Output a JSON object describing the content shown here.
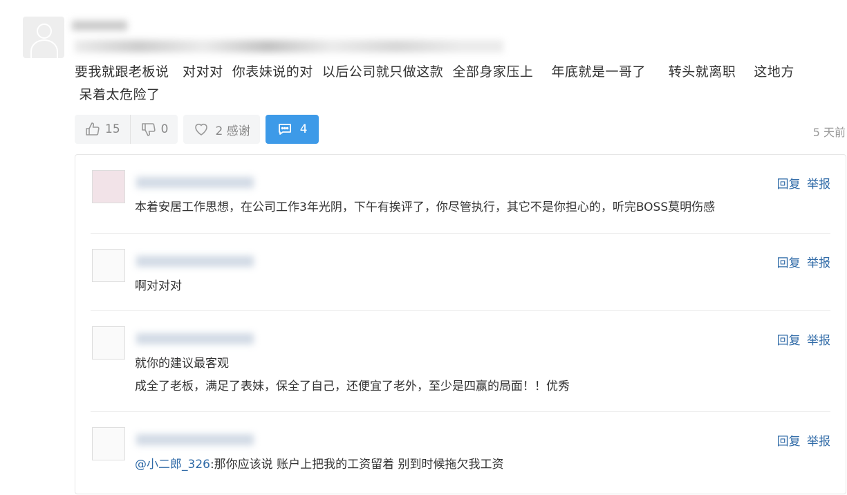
{
  "comment": {
    "body": "要我就跟老板说   对对对  你表妹说的对  以后公司就只做这款  全部身家压上    年底就是一哥了     转头就离职    这地方\n 呆着太危险了",
    "likes": "15",
    "dislikes": "0",
    "thanks": "2 感谢",
    "comment_count": "4",
    "time": "5 天前"
  },
  "colors": {
    "accent": "#3d9ae8",
    "link": "#2f6aa7",
    "pill_bg": "#f4f5f6"
  },
  "reply_actions": {
    "reply": "回复",
    "report": "举报"
  },
  "replies": [
    {
      "text": "本着安居工作思想，在公司工作3年光阴，下午有挨评了，你尽管执行，其它不是你担心的，听完BOSS莫明伤感"
    },
    {
      "text": "啊对对对"
    },
    {
      "line1": "就你的建议最客观",
      "line2": "成全了老板，满足了表妹，保全了自己，还便宜了老外，至少是四赢的局面！！优秀"
    },
    {
      "mention": "@小二郎_326",
      "text": ":那你应该说 账户上把我的工资留着 别到时候拖欠我工资"
    }
  ]
}
